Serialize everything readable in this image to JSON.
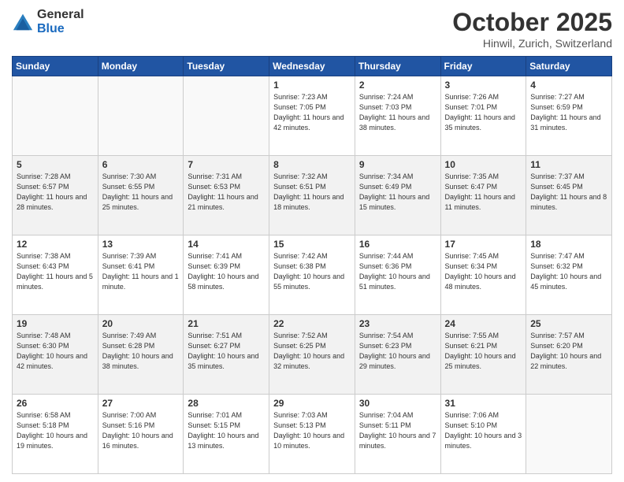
{
  "logo": {
    "general": "General",
    "blue": "Blue"
  },
  "header": {
    "month": "October 2025",
    "location": "Hinwil, Zurich, Switzerland"
  },
  "days_of_week": [
    "Sunday",
    "Monday",
    "Tuesday",
    "Wednesday",
    "Thursday",
    "Friday",
    "Saturday"
  ],
  "weeks": [
    [
      {
        "day": "",
        "info": ""
      },
      {
        "day": "",
        "info": ""
      },
      {
        "day": "",
        "info": ""
      },
      {
        "day": "1",
        "info": "Sunrise: 7:23 AM\nSunset: 7:05 PM\nDaylight: 11 hours and 42 minutes."
      },
      {
        "day": "2",
        "info": "Sunrise: 7:24 AM\nSunset: 7:03 PM\nDaylight: 11 hours and 38 minutes."
      },
      {
        "day": "3",
        "info": "Sunrise: 7:26 AM\nSunset: 7:01 PM\nDaylight: 11 hours and 35 minutes."
      },
      {
        "day": "4",
        "info": "Sunrise: 7:27 AM\nSunset: 6:59 PM\nDaylight: 11 hours and 31 minutes."
      }
    ],
    [
      {
        "day": "5",
        "info": "Sunrise: 7:28 AM\nSunset: 6:57 PM\nDaylight: 11 hours and 28 minutes."
      },
      {
        "day": "6",
        "info": "Sunrise: 7:30 AM\nSunset: 6:55 PM\nDaylight: 11 hours and 25 minutes."
      },
      {
        "day": "7",
        "info": "Sunrise: 7:31 AM\nSunset: 6:53 PM\nDaylight: 11 hours and 21 minutes."
      },
      {
        "day": "8",
        "info": "Sunrise: 7:32 AM\nSunset: 6:51 PM\nDaylight: 11 hours and 18 minutes."
      },
      {
        "day": "9",
        "info": "Sunrise: 7:34 AM\nSunset: 6:49 PM\nDaylight: 11 hours and 15 minutes."
      },
      {
        "day": "10",
        "info": "Sunrise: 7:35 AM\nSunset: 6:47 PM\nDaylight: 11 hours and 11 minutes."
      },
      {
        "day": "11",
        "info": "Sunrise: 7:37 AM\nSunset: 6:45 PM\nDaylight: 11 hours and 8 minutes."
      }
    ],
    [
      {
        "day": "12",
        "info": "Sunrise: 7:38 AM\nSunset: 6:43 PM\nDaylight: 11 hours and 5 minutes."
      },
      {
        "day": "13",
        "info": "Sunrise: 7:39 AM\nSunset: 6:41 PM\nDaylight: 11 hours and 1 minute."
      },
      {
        "day": "14",
        "info": "Sunrise: 7:41 AM\nSunset: 6:39 PM\nDaylight: 10 hours and 58 minutes."
      },
      {
        "day": "15",
        "info": "Sunrise: 7:42 AM\nSunset: 6:38 PM\nDaylight: 10 hours and 55 minutes."
      },
      {
        "day": "16",
        "info": "Sunrise: 7:44 AM\nSunset: 6:36 PM\nDaylight: 10 hours and 51 minutes."
      },
      {
        "day": "17",
        "info": "Sunrise: 7:45 AM\nSunset: 6:34 PM\nDaylight: 10 hours and 48 minutes."
      },
      {
        "day": "18",
        "info": "Sunrise: 7:47 AM\nSunset: 6:32 PM\nDaylight: 10 hours and 45 minutes."
      }
    ],
    [
      {
        "day": "19",
        "info": "Sunrise: 7:48 AM\nSunset: 6:30 PM\nDaylight: 10 hours and 42 minutes."
      },
      {
        "day": "20",
        "info": "Sunrise: 7:49 AM\nSunset: 6:28 PM\nDaylight: 10 hours and 38 minutes."
      },
      {
        "day": "21",
        "info": "Sunrise: 7:51 AM\nSunset: 6:27 PM\nDaylight: 10 hours and 35 minutes."
      },
      {
        "day": "22",
        "info": "Sunrise: 7:52 AM\nSunset: 6:25 PM\nDaylight: 10 hours and 32 minutes."
      },
      {
        "day": "23",
        "info": "Sunrise: 7:54 AM\nSunset: 6:23 PM\nDaylight: 10 hours and 29 minutes."
      },
      {
        "day": "24",
        "info": "Sunrise: 7:55 AM\nSunset: 6:21 PM\nDaylight: 10 hours and 25 minutes."
      },
      {
        "day": "25",
        "info": "Sunrise: 7:57 AM\nSunset: 6:20 PM\nDaylight: 10 hours and 22 minutes."
      }
    ],
    [
      {
        "day": "26",
        "info": "Sunrise: 6:58 AM\nSunset: 5:18 PM\nDaylight: 10 hours and 19 minutes."
      },
      {
        "day": "27",
        "info": "Sunrise: 7:00 AM\nSunset: 5:16 PM\nDaylight: 10 hours and 16 minutes."
      },
      {
        "day": "28",
        "info": "Sunrise: 7:01 AM\nSunset: 5:15 PM\nDaylight: 10 hours and 13 minutes."
      },
      {
        "day": "29",
        "info": "Sunrise: 7:03 AM\nSunset: 5:13 PM\nDaylight: 10 hours and 10 minutes."
      },
      {
        "day": "30",
        "info": "Sunrise: 7:04 AM\nSunset: 5:11 PM\nDaylight: 10 hours and 7 minutes."
      },
      {
        "day": "31",
        "info": "Sunrise: 7:06 AM\nSunset: 5:10 PM\nDaylight: 10 hours and 3 minutes."
      },
      {
        "day": "",
        "info": ""
      }
    ]
  ]
}
